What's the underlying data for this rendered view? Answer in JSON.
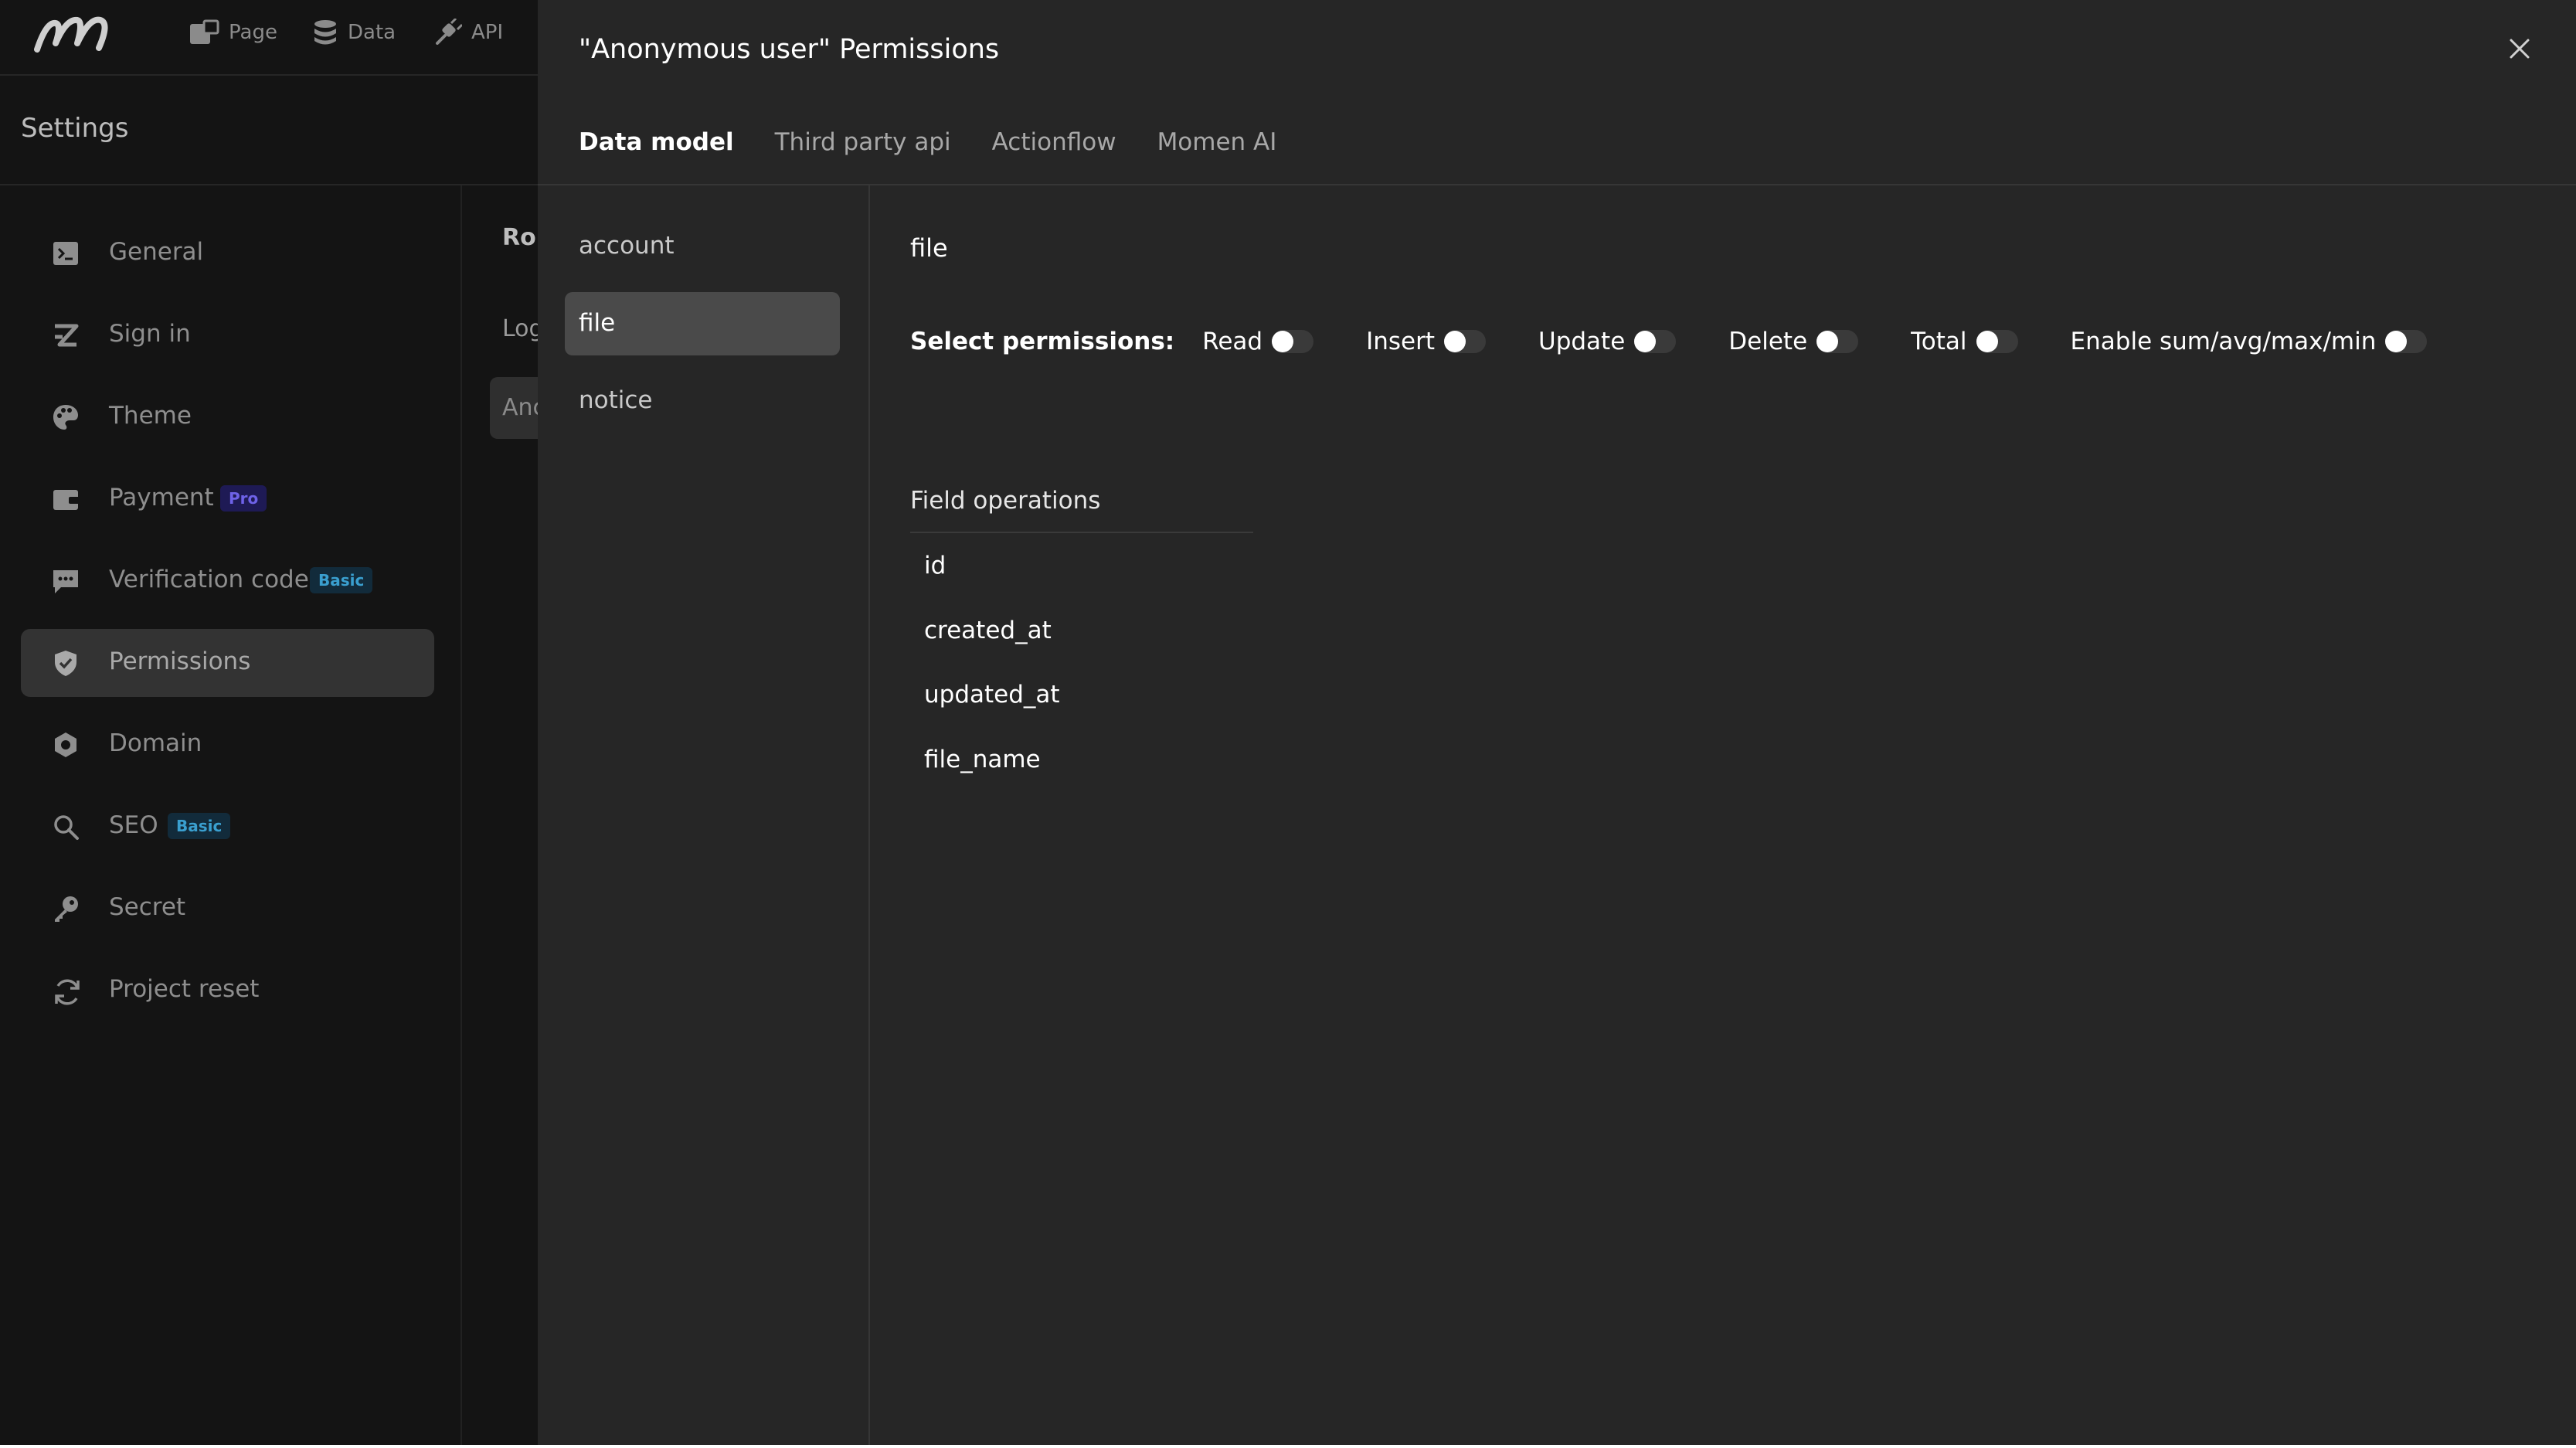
{
  "topbar": {
    "logo_icon": "momen-logo-icon",
    "nav": [
      {
        "label": "Page",
        "icon": "page-icon"
      },
      {
        "label": "Data",
        "icon": "database-icon"
      },
      {
        "label": "API",
        "icon": "api-plug-icon"
      }
    ]
  },
  "settings": {
    "title": "Settings"
  },
  "sidebar": {
    "items": [
      {
        "label": "General",
        "icon": "terminal-icon"
      },
      {
        "label": "Sign in",
        "icon": "sign-in-icon"
      },
      {
        "label": "Theme",
        "icon": "palette-icon"
      },
      {
        "label": "Payment",
        "icon": "wallet-icon",
        "badge": "Pro"
      },
      {
        "label": "Verification code",
        "icon": "message-icon",
        "badge": "Basic"
      },
      {
        "label": "Permissions",
        "icon": "shield-icon",
        "active": true
      },
      {
        "label": "Domain",
        "icon": "domain-icon"
      },
      {
        "label": "SEO",
        "icon": "search-icon",
        "badge": "Basic"
      },
      {
        "label": "Secret",
        "icon": "key-icon"
      },
      {
        "label": "Project reset",
        "icon": "refresh-icon"
      }
    ]
  },
  "middle": {
    "role_label": "Rol",
    "log_label": "Log",
    "anon_label": "Anc"
  },
  "modal": {
    "title": "\"Anonymous user\" Permissions",
    "tabs": [
      {
        "label": "Data model",
        "active": true
      },
      {
        "label": "Third party api"
      },
      {
        "label": "Actionflow"
      },
      {
        "label": "Momen AI"
      }
    ],
    "tables": [
      {
        "label": "account"
      },
      {
        "label": "file",
        "active": true
      },
      {
        "label": "notice"
      }
    ],
    "selected_table": "file",
    "permissions_label": "Select permissions:",
    "permissions": [
      {
        "label": "Read",
        "enabled": false
      },
      {
        "label": "Insert",
        "enabled": false
      },
      {
        "label": "Update",
        "enabled": false
      },
      {
        "label": "Delete",
        "enabled": false
      },
      {
        "label": "Total",
        "enabled": false
      },
      {
        "label": "Enable sum/avg/max/min",
        "enabled": false
      }
    ],
    "field_operations_title": "Field operations",
    "fields": [
      "id",
      "created_at",
      "updated_at",
      "file_name"
    ]
  },
  "colors": {
    "background": "#141414",
    "modal": "#262626",
    "active_item": "#333333",
    "pro_badge": "#6e62e8",
    "basic_badge": "#3a9fcf"
  }
}
